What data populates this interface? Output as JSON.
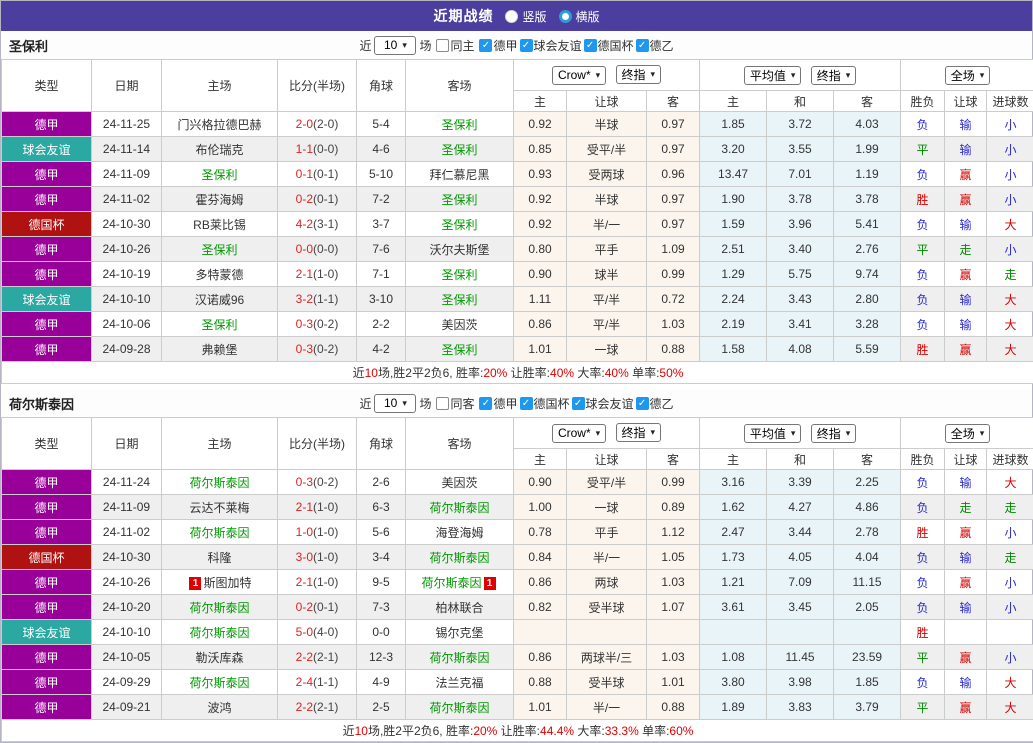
{
  "title_bar": {
    "title": "近期战绩",
    "vertical_label": "竖版",
    "vertical_checked": false,
    "horizontal_label": "横版",
    "horizontal_checked": true
  },
  "labels": {
    "near": "近",
    "field": "场"
  },
  "headers": {
    "type": "类型",
    "date": "日期",
    "home": "主场",
    "score": "比分(半场)",
    "corner": "角球",
    "away": "客场",
    "crow_select": "Crow*",
    "final_select": "终指",
    "avg_select": "平均值",
    "avg_final_select": "终指",
    "full_select": "全场",
    "odds_home": "主",
    "odds_handicap": "让球",
    "odds_away": "客",
    "avg_home": "主",
    "avg_draw": "和",
    "avg_away": "客",
    "wdl": "胜负",
    "handicap_result": "让球",
    "goals": "进球数"
  },
  "colors": {
    "titlebar_bg": "#4B3E9E",
    "checkbox_blue": "#1E97EE",
    "radio_blue": "#2D9CDB",
    "score_red": "#E02222",
    "team_green": "#009900",
    "win_red": "#D50000",
    "draw_green": "#008800",
    "lose_blue": "#2929CC",
    "summary_red": "#E00000"
  },
  "type_colors": {
    "德甲": "#990099",
    "球会友谊": "#2BA8A2",
    "德国杯": "#B01212"
  },
  "result_classes": {
    "胜": "r",
    "平": "g",
    "负": "b",
    "赢": "r",
    "输": "b",
    "走": "g",
    "大": "r",
    "小": "b"
  },
  "sections": [
    {
      "team": "圣保利",
      "count": "10",
      "same_label": "同主",
      "same_checked": false,
      "leagues": [
        {
          "label": "德甲",
          "checked": true
        },
        {
          "label": "球会友谊",
          "checked": true
        },
        {
          "label": "德国杯",
          "checked": true
        },
        {
          "label": "德乙",
          "checked": true
        }
      ],
      "rows": [
        {
          "type": "德甲",
          "date": "24-11-25",
          "home": "门兴格拉德巴赫",
          "hs": false,
          "hcard": "",
          "score": "2-0",
          "half": "(2-0)",
          "corner": "5-4",
          "away": "圣保利",
          "as": true,
          "acard": "",
          "o1": "0.92",
          "oh": "半球",
          "o2": "0.97",
          "m1": "1.85",
          "m2": "3.72",
          "m3": "4.03",
          "r1": "负",
          "r2": "输",
          "r3": "小"
        },
        {
          "type": "球会友谊",
          "date": "24-11-14",
          "home": "布伦瑞克",
          "hs": false,
          "hcard": "",
          "score": "1-1",
          "half": "(0-0)",
          "corner": "4-6",
          "away": "圣保利",
          "as": true,
          "acard": "",
          "o1": "0.85",
          "oh": "受平/半",
          "o2": "0.97",
          "m1": "3.20",
          "m2": "3.55",
          "m3": "1.99",
          "r1": "平",
          "r2": "输",
          "r3": "小"
        },
        {
          "type": "德甲",
          "date": "24-11-09",
          "home": "圣保利",
          "hs": true,
          "hcard": "",
          "score": "0-1",
          "half": "(0-1)",
          "corner": "5-10",
          "away": "拜仁慕尼黑",
          "as": false,
          "acard": "",
          "o1": "0.93",
          "oh": "受两球",
          "o2": "0.96",
          "m1": "13.47",
          "m2": "7.01",
          "m3": "1.19",
          "r1": "负",
          "r2": "赢",
          "r3": "小"
        },
        {
          "type": "德甲",
          "date": "24-11-02",
          "home": "霍芬海姆",
          "hs": false,
          "hcard": "",
          "score": "0-2",
          "half": "(0-1)",
          "corner": "7-2",
          "away": "圣保利",
          "as": true,
          "acard": "",
          "o1": "0.92",
          "oh": "半球",
          "o2": "0.97",
          "m1": "1.90",
          "m2": "3.78",
          "m3": "3.78",
          "r1": "胜",
          "r2": "赢",
          "r3": "小"
        },
        {
          "type": "德国杯",
          "date": "24-10-30",
          "home": "RB莱比锡",
          "hs": false,
          "hcard": "",
          "score": "4-2",
          "half": "(3-1)",
          "corner": "3-7",
          "away": "圣保利",
          "as": true,
          "acard": "",
          "o1": "0.92",
          "oh": "半/一",
          "o2": "0.97",
          "m1": "1.59",
          "m2": "3.96",
          "m3": "5.41",
          "r1": "负",
          "r2": "输",
          "r3": "大"
        },
        {
          "type": "德甲",
          "date": "24-10-26",
          "home": "圣保利",
          "hs": true,
          "hcard": "",
          "score": "0-0",
          "half": "(0-0)",
          "corner": "7-6",
          "away": "沃尔夫斯堡",
          "as": false,
          "acard": "",
          "o1": "0.80",
          "oh": "平手",
          "o2": "1.09",
          "m1": "2.51",
          "m2": "3.40",
          "m3": "2.76",
          "r1": "平",
          "r2": "走",
          "r3": "小"
        },
        {
          "type": "德甲",
          "date": "24-10-19",
          "home": "多特蒙德",
          "hs": false,
          "hcard": "",
          "score": "2-1",
          "half": "(1-0)",
          "corner": "7-1",
          "away": "圣保利",
          "as": true,
          "acard": "",
          "o1": "0.90",
          "oh": "球半",
          "o2": "0.99",
          "m1": "1.29",
          "m2": "5.75",
          "m3": "9.74",
          "r1": "负",
          "r2": "赢",
          "r3": "走"
        },
        {
          "type": "球会友谊",
          "date": "24-10-10",
          "home": "汉诺威96",
          "hs": false,
          "hcard": "",
          "score": "3-2",
          "half": "(1-1)",
          "corner": "3-10",
          "away": "圣保利",
          "as": true,
          "acard": "",
          "o1": "1.11",
          "oh": "平/半",
          "o2": "0.72",
          "m1": "2.24",
          "m2": "3.43",
          "m3": "2.80",
          "r1": "负",
          "r2": "输",
          "r3": "大"
        },
        {
          "type": "德甲",
          "date": "24-10-06",
          "home": "圣保利",
          "hs": true,
          "hcard": "",
          "score": "0-3",
          "half": "(0-2)",
          "corner": "2-2",
          "away": "美因茨",
          "as": false,
          "acard": "",
          "o1": "0.86",
          "oh": "平/半",
          "o2": "1.03",
          "m1": "2.19",
          "m2": "3.41",
          "m3": "3.28",
          "r1": "负",
          "r2": "输",
          "r3": "大"
        },
        {
          "type": "德甲",
          "date": "24-09-28",
          "home": "弗赖堡",
          "hs": false,
          "hcard": "",
          "score": "0-3",
          "half": "(0-2)",
          "corner": "4-2",
          "away": "圣保利",
          "as": true,
          "acard": "",
          "o1": "1.01",
          "oh": "一球",
          "o2": "0.88",
          "m1": "1.58",
          "m2": "4.08",
          "m3": "5.59",
          "r1": "胜",
          "r2": "赢",
          "r3": "大"
        }
      ],
      "summary": [
        {
          "t": "近",
          "c": "k"
        },
        {
          "t": "10",
          "c": "r"
        },
        {
          "t": "场,胜2平2负6, 胜率:",
          "c": "k"
        },
        {
          "t": "20%",
          "c": "r"
        },
        {
          "t": " 让胜率:",
          "c": "k"
        },
        {
          "t": "40%",
          "c": "r"
        },
        {
          "t": " 大率:",
          "c": "k"
        },
        {
          "t": "40%",
          "c": "r"
        },
        {
          "t": " 单率:",
          "c": "k"
        },
        {
          "t": "50%",
          "c": "r"
        }
      ]
    },
    {
      "team": "荷尔斯泰因",
      "count": "10",
      "same_label": "同客",
      "same_checked": false,
      "leagues": [
        {
          "label": "德甲",
          "checked": true
        },
        {
          "label": "德国杯",
          "checked": true
        },
        {
          "label": "球会友谊",
          "checked": true
        },
        {
          "label": "德乙",
          "checked": true
        }
      ],
      "rows": [
        {
          "type": "德甲",
          "date": "24-11-24",
          "home": "荷尔斯泰因",
          "hs": true,
          "hcard": "",
          "score": "0-3",
          "half": "(0-2)",
          "corner": "2-6",
          "away": "美因茨",
          "as": false,
          "acard": "",
          "o1": "0.90",
          "oh": "受平/半",
          "o2": "0.99",
          "m1": "3.16",
          "m2": "3.39",
          "m3": "2.25",
          "r1": "负",
          "r2": "输",
          "r3": "大"
        },
        {
          "type": "德甲",
          "date": "24-11-09",
          "home": "云达不莱梅",
          "hs": false,
          "hcard": "",
          "score": "2-1",
          "half": "(1-0)",
          "corner": "6-3",
          "away": "荷尔斯泰因",
          "as": true,
          "acard": "",
          "o1": "1.00",
          "oh": "一球",
          "o2": "0.89",
          "m1": "1.62",
          "m2": "4.27",
          "m3": "4.86",
          "r1": "负",
          "r2": "走",
          "r3": "走"
        },
        {
          "type": "德甲",
          "date": "24-11-02",
          "home": "荷尔斯泰因",
          "hs": true,
          "hcard": "",
          "score": "1-0",
          "half": "(1-0)",
          "corner": "5-6",
          "away": "海登海姆",
          "as": false,
          "acard": "",
          "o1": "0.78",
          "oh": "平手",
          "o2": "1.12",
          "m1": "2.47",
          "m2": "3.44",
          "m3": "2.78",
          "r1": "胜",
          "r2": "赢",
          "r3": "小"
        },
        {
          "type": "德国杯",
          "date": "24-10-30",
          "home": "科隆",
          "hs": false,
          "hcard": "",
          "score": "3-0",
          "half": "(1-0)",
          "corner": "3-4",
          "away": "荷尔斯泰因",
          "as": true,
          "acard": "",
          "o1": "0.84",
          "oh": "半/一",
          "o2": "1.05",
          "m1": "1.73",
          "m2": "4.05",
          "m3": "4.04",
          "r1": "负",
          "r2": "输",
          "r3": "走"
        },
        {
          "type": "德甲",
          "date": "24-10-26",
          "home": "斯图加特",
          "hs": false,
          "hcard": "1",
          "score": "2-1",
          "half": "(1-0)",
          "corner": "9-5",
          "away": "荷尔斯泰因",
          "as": true,
          "acard": "1",
          "o1": "0.86",
          "oh": "两球",
          "o2": "1.03",
          "m1": "1.21",
          "m2": "7.09",
          "m3": "11.15",
          "r1": "负",
          "r2": "赢",
          "r3": "小"
        },
        {
          "type": "德甲",
          "date": "24-10-20",
          "home": "荷尔斯泰因",
          "hs": true,
          "hcard": "",
          "score": "0-2",
          "half": "(0-1)",
          "corner": "7-3",
          "away": "柏林联合",
          "as": false,
          "acard": "",
          "o1": "0.82",
          "oh": "受半球",
          "o2": "1.07",
          "m1": "3.61",
          "m2": "3.45",
          "m3": "2.05",
          "r1": "负",
          "r2": "输",
          "r3": "小"
        },
        {
          "type": "球会友谊",
          "date": "24-10-10",
          "home": "荷尔斯泰因",
          "hs": true,
          "hcard": "",
          "score": "5-0",
          "half": "(4-0)",
          "corner": "0-0",
          "away": "锡尔克堡",
          "as": false,
          "acard": "",
          "o1": "",
          "oh": "",
          "o2": "",
          "m1": "",
          "m2": "",
          "m3": "",
          "r1": "胜",
          "r2": "",
          "r3": ""
        },
        {
          "type": "德甲",
          "date": "24-10-05",
          "home": "勒沃库森",
          "hs": false,
          "hcard": "",
          "score": "2-2",
          "half": "(2-1)",
          "corner": "12-3",
          "away": "荷尔斯泰因",
          "as": true,
          "acard": "",
          "o1": "0.86",
          "oh": "两球半/三",
          "o2": "1.03",
          "m1": "1.08",
          "m2": "11.45",
          "m3": "23.59",
          "r1": "平",
          "r2": "赢",
          "r3": "小"
        },
        {
          "type": "德甲",
          "date": "24-09-29",
          "home": "荷尔斯泰因",
          "hs": true,
          "hcard": "",
          "score": "2-4",
          "half": "(1-1)",
          "corner": "4-9",
          "away": "法兰克福",
          "as": false,
          "acard": "",
          "o1": "0.88",
          "oh": "受半球",
          "o2": "1.01",
          "m1": "3.80",
          "m2": "3.98",
          "m3": "1.85",
          "r1": "负",
          "r2": "输",
          "r3": "大"
        },
        {
          "type": "德甲",
          "date": "24-09-21",
          "home": "波鸿",
          "hs": false,
          "hcard": "",
          "score": "2-2",
          "half": "(2-1)",
          "corner": "2-5",
          "away": "荷尔斯泰因",
          "as": true,
          "acard": "",
          "o1": "1.01",
          "oh": "半/一",
          "o2": "0.88",
          "m1": "1.89",
          "m2": "3.83",
          "m3": "3.79",
          "r1": "平",
          "r2": "赢",
          "r3": "大"
        }
      ],
      "summary": [
        {
          "t": "近",
          "c": "k"
        },
        {
          "t": "10",
          "c": "r"
        },
        {
          "t": "场,胜2平2负6, 胜率:",
          "c": "k"
        },
        {
          "t": "20%",
          "c": "r"
        },
        {
          "t": " 让胜率:",
          "c": "k"
        },
        {
          "t": "44.4%",
          "c": "r"
        },
        {
          "t": " 大率:",
          "c": "k"
        },
        {
          "t": "33.3%",
          "c": "r"
        },
        {
          "t": " 单率:",
          "c": "k"
        },
        {
          "t": "60%",
          "c": "r"
        }
      ]
    }
  ]
}
